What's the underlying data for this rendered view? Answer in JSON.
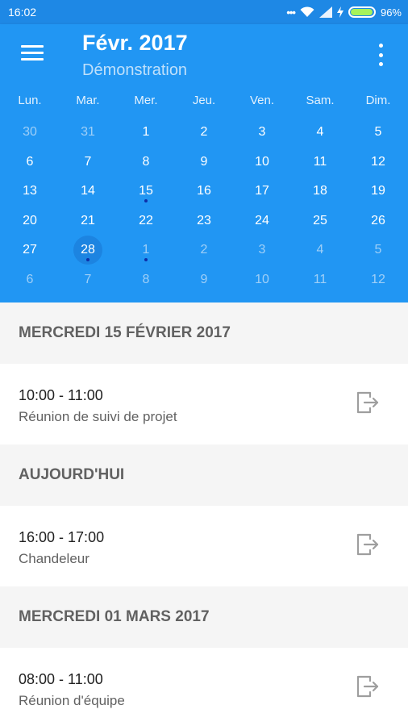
{
  "status": {
    "time": "16:02",
    "battery": "96%",
    "battery_level": 0.96
  },
  "header": {
    "title": "Févr. 2017",
    "subtitle": "Démonstration"
  },
  "weekdays": [
    "Lun.",
    "Mar.",
    "Mer.",
    "Jeu.",
    "Ven.",
    "Sam.",
    "Dim."
  ],
  "weeks": [
    [
      {
        "d": "30",
        "m": true
      },
      {
        "d": "31",
        "m": true
      },
      {
        "d": "1"
      },
      {
        "d": "2"
      },
      {
        "d": "3"
      },
      {
        "d": "4"
      },
      {
        "d": "5"
      }
    ],
    [
      {
        "d": "6"
      },
      {
        "d": "7"
      },
      {
        "d": "8"
      },
      {
        "d": "9"
      },
      {
        "d": "10"
      },
      {
        "d": "11"
      },
      {
        "d": "12"
      }
    ],
    [
      {
        "d": "13"
      },
      {
        "d": "14"
      },
      {
        "d": "15",
        "dot": true
      },
      {
        "d": "16"
      },
      {
        "d": "17"
      },
      {
        "d": "18"
      },
      {
        "d": "19"
      }
    ],
    [
      {
        "d": "20"
      },
      {
        "d": "21"
      },
      {
        "d": "22"
      },
      {
        "d": "23"
      },
      {
        "d": "24"
      },
      {
        "d": "25"
      },
      {
        "d": "26"
      }
    ],
    [
      {
        "d": "27"
      },
      {
        "d": "28",
        "today": true,
        "dot": true
      },
      {
        "d": "1",
        "m": true,
        "dot": true
      },
      {
        "d": "2",
        "m": true
      },
      {
        "d": "3",
        "m": true
      },
      {
        "d": "4",
        "m": true
      },
      {
        "d": "5",
        "m": true
      }
    ],
    [
      {
        "d": "6",
        "m": true
      },
      {
        "d": "7",
        "m": true
      },
      {
        "d": "8",
        "m": true
      },
      {
        "d": "9",
        "m": true
      },
      {
        "d": "10",
        "m": true
      },
      {
        "d": "11",
        "m": true
      },
      {
        "d": "12",
        "m": true
      }
    ]
  ],
  "agenda": [
    {
      "heading": "MERCREDI 15 FÉVRIER 2017",
      "time": "10:00 - 11:00",
      "title": "Réunion de suivi de projet"
    },
    {
      "heading": "AUJOURD'HUI",
      "time": "16:00 - 17:00",
      "title": "Chandeleur"
    },
    {
      "heading": "MERCREDI 01 MARS 2017",
      "time": "08:00 - 11:00",
      "title": "Réunion d'équipe"
    }
  ],
  "colors": {
    "status_bar": "#1e88e5",
    "header": "#2196f3",
    "event_dot": "#0d2fa8",
    "today_circle": "#1976d2"
  },
  "icons": {
    "menu": "hamburger-menu-icon",
    "more": "more-vert-icon",
    "event_action": "exit-to-app-icon"
  }
}
